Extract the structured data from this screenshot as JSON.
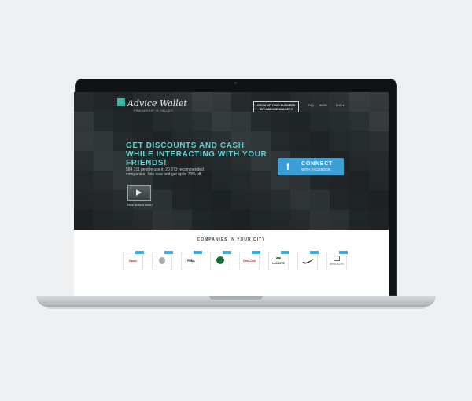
{
  "header": {
    "logo_text": "Advice Wallet",
    "tagline": "FRIENDSHIP IS VALUED",
    "grow_button": "GROW UP YOUR BUSINESS WITH ADVICE WALLET.!!",
    "nav": [
      "FAQ",
      "BLOG"
    ],
    "language": "ENG ▾"
  },
  "hero": {
    "headline": "GET DISCOUNTS AND CASH WHILE INTERACTING WITH YOUR FRIENDS!",
    "subtext": "584 211 people use it. 20 873 recommended companies. Join now and get up to 70% off.",
    "video_label": "How does it work?",
    "connect_title": "CONNECT",
    "connect_sub": "WITH FACEBOOK",
    "accent_color": "#5fd3d0",
    "button_color": "#3a9fd7"
  },
  "companies": {
    "title": "COMPANIES IN YOUR CITY",
    "logos": [
      {
        "brand": "Canon",
        "color": "#d4171f"
      },
      {
        "brand": "",
        "color": "#a7adb2"
      },
      {
        "brand": "PUMA",
        "color": "#111111"
      },
      {
        "brand": "",
        "color": "#1e6e3c"
      },
      {
        "brand": "Coca-Cola",
        "color": "#d4171f"
      },
      {
        "brand": "LACOSTE",
        "color": "#111111"
      },
      {
        "brand": "",
        "color": "#111111"
      },
      {
        "brand": "BROOKLYN",
        "color": "#555555"
      }
    ]
  }
}
